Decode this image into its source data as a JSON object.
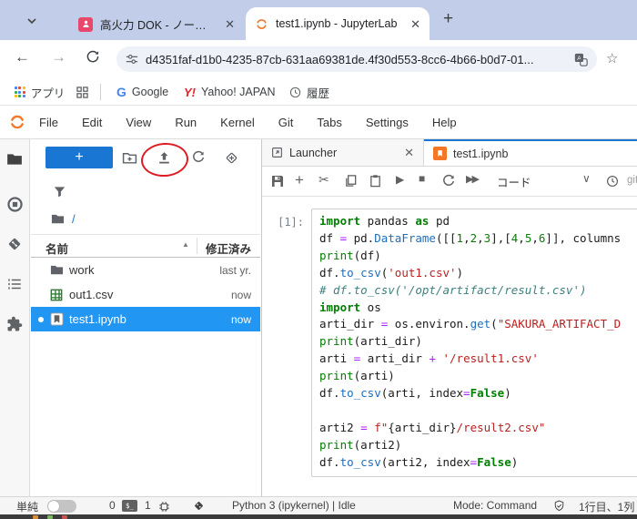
{
  "browser": {
    "tabs": [
      {
        "title": "高火力 DOK - ノートブック"
      },
      {
        "title": "test1.ipynb - JupyterLab"
      }
    ],
    "new_tab_label": "+",
    "url": "d4351faf-d1b0-4235-87cb-631aa69381de.4f30d553-8cc6-4b66-b0d7-01...",
    "bookmarks": {
      "apps": "アプリ",
      "google": "Google",
      "yahoo": "Yahoo! JAPAN",
      "history": "履歴"
    }
  },
  "jupyter": {
    "menu": [
      "File",
      "Edit",
      "View",
      "Run",
      "Kernel",
      "Git",
      "Tabs",
      "Settings",
      "Help"
    ],
    "filebrowser": {
      "breadcrumb": "/",
      "name_header": "名前",
      "modified_header": "修正済み",
      "files": [
        {
          "name": "work",
          "modified": "last yr.",
          "type": "folder",
          "selected": false,
          "running": false
        },
        {
          "name": "out1.csv",
          "modified": "now",
          "type": "csv",
          "selected": false,
          "running": false
        },
        {
          "name": "test1.ipynb",
          "modified": "now",
          "type": "notebook",
          "selected": true,
          "running": true
        }
      ]
    },
    "tabs": [
      {
        "label": "Launcher"
      },
      {
        "label": "test1.ipynb"
      }
    ],
    "toolbar": {
      "cell_type": "コード",
      "git_label": "git"
    },
    "cell": {
      "prompt": "[1]:",
      "lines": [
        [
          [
            "import",
            "kw"
          ],
          [
            " pandas ",
            "pl"
          ],
          [
            "as",
            "kw"
          ],
          [
            " pd",
            "pl"
          ]
        ],
        [
          [
            "df ",
            "pl"
          ],
          [
            "=",
            "op"
          ],
          [
            " pd.",
            "pl"
          ],
          [
            "DataFrame",
            "fn"
          ],
          [
            "([[",
            "pl"
          ],
          [
            "1",
            "num"
          ],
          [
            ",",
            "pl"
          ],
          [
            "2",
            "num"
          ],
          [
            ",",
            "pl"
          ],
          [
            "3",
            "num"
          ],
          [
            "],[",
            "pl"
          ],
          [
            "4",
            "num"
          ],
          [
            ",",
            "pl"
          ],
          [
            "5",
            "num"
          ],
          [
            ",",
            "pl"
          ],
          [
            "6",
            "num"
          ],
          [
            "]], columns",
            "pl"
          ]
        ],
        [
          [
            "print",
            "bi"
          ],
          [
            "(df)",
            "pl"
          ]
        ],
        [
          [
            "df.",
            "pl"
          ],
          [
            "to_csv",
            "fn"
          ],
          [
            "(",
            "pl"
          ],
          [
            "'out1.csv'",
            "str"
          ],
          [
            ")",
            "pl"
          ]
        ],
        [
          [
            "# df.to_csv('/opt/artifact/result.csv')",
            "com"
          ]
        ],
        [
          [
            "import",
            "kw"
          ],
          [
            " os",
            "pl"
          ]
        ],
        [
          [
            "arti_dir ",
            "pl"
          ],
          [
            "=",
            "op"
          ],
          [
            " os.environ.",
            "pl"
          ],
          [
            "get",
            "fn"
          ],
          [
            "(",
            "pl"
          ],
          [
            "\"SAKURA_ARTIFACT_D",
            "str"
          ]
        ],
        [
          [
            "print",
            "bi"
          ],
          [
            "(arti_dir)",
            "pl"
          ]
        ],
        [
          [
            "arti ",
            "pl"
          ],
          [
            "=",
            "op"
          ],
          [
            " arti_dir ",
            "pl"
          ],
          [
            "+",
            "op"
          ],
          [
            " ",
            "pl"
          ],
          [
            "'/result1.csv'",
            "str"
          ]
        ],
        [
          [
            "print",
            "bi"
          ],
          [
            "(arti)",
            "pl"
          ]
        ],
        [
          [
            "df.",
            "pl"
          ],
          [
            "to_csv",
            "fn"
          ],
          [
            "(arti, index",
            "pl"
          ],
          [
            "=",
            "op"
          ],
          [
            "False",
            "kw"
          ],
          [
            ")",
            "pl"
          ]
        ],
        [],
        [
          [
            "arti2 ",
            "pl"
          ],
          [
            "=",
            "op"
          ],
          [
            " ",
            "pl"
          ],
          [
            "f\"",
            "str"
          ],
          [
            "{arti_dir}",
            "brace"
          ],
          [
            "/result2.csv\"",
            "str"
          ]
        ],
        [
          [
            "print",
            "bi"
          ],
          [
            "(arti2)",
            "pl"
          ]
        ],
        [
          [
            "df.",
            "pl"
          ],
          [
            "to_csv",
            "fn"
          ],
          [
            "(arti2, index",
            "pl"
          ],
          [
            "=",
            "op"
          ],
          [
            "False",
            "kw"
          ],
          [
            ")",
            "pl"
          ]
        ]
      ]
    },
    "statusbar": {
      "simple_label": "単純",
      "terminals_count": "0",
      "terminal_glyph": "$_",
      "kernels_count": "1",
      "kernel_status": "Python 3 (ipykernel) | Idle",
      "mode": "Mode: Command",
      "cursor_position": "1行目、1列"
    },
    "colors": {
      "accent": "#1976d2",
      "selection": "#2196f3",
      "notebook_icon": "#f37726",
      "annotation_circle": "#dd1c24"
    }
  }
}
